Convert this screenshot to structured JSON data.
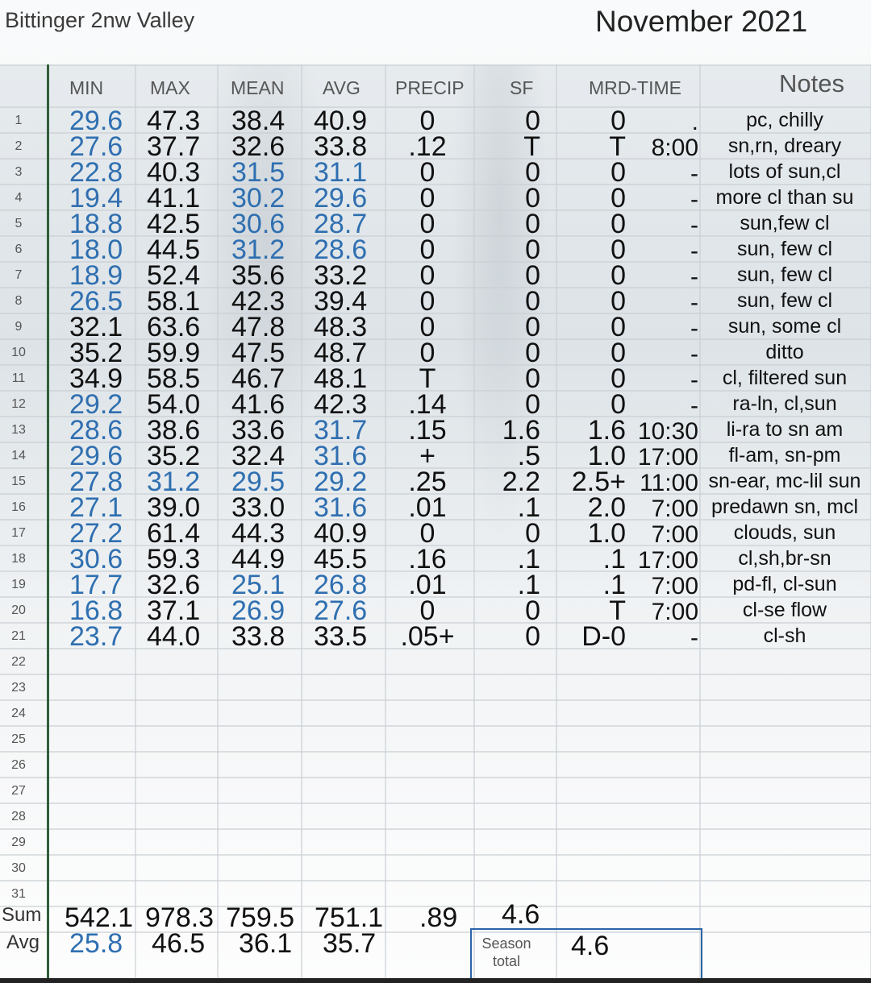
{
  "header": {
    "station": "Bittinger 2nw Valley",
    "month": "November 2021"
  },
  "columns": [
    "MIN",
    "MAX",
    "MEAN",
    "AVG",
    "PRECIP",
    "SF",
    "MRD-TIME",
    "Notes"
  ],
  "rows": [
    {
      "n": "1",
      "min": "29.6",
      "max": "47.3",
      "mean": "38.4",
      "avg": "40.9",
      "precip": "0",
      "sf": "0",
      "mrd": "0",
      "time": ".",
      "note": "pc, chilly"
    },
    {
      "n": "2",
      "min": "27.6",
      "max": "37.7",
      "mean": "32.6",
      "avg": "33.8",
      "precip": ".12",
      "sf": "T",
      "mrd": "T",
      "time": "8:00",
      "note": "sn,rn, dreary"
    },
    {
      "n": "3",
      "min": "22.8",
      "max": "40.3",
      "mean": "31.5",
      "avg": "31.1",
      "precip": "0",
      "sf": "0",
      "mrd": "0",
      "time": "-",
      "note": "lots of sun,cl"
    },
    {
      "n": "4",
      "min": "19.4",
      "max": "41.1",
      "mean": "30.2",
      "avg": "29.6",
      "precip": "0",
      "sf": "0",
      "mrd": "0",
      "time": "-",
      "note": "more cl than su"
    },
    {
      "n": "5",
      "min": "18.8",
      "max": "42.5",
      "mean": "30.6",
      "avg": "28.7",
      "precip": "0",
      "sf": "0",
      "mrd": "0",
      "time": "-",
      "note": "sun,few cl"
    },
    {
      "n": "6",
      "min": "18.0",
      "max": "44.5",
      "mean": "31.2",
      "avg": "28.6",
      "precip": "0",
      "sf": "0",
      "mrd": "0",
      "time": "-",
      "note": "sun, few cl"
    },
    {
      "n": "7",
      "min": "18.9",
      "max": "52.4",
      "mean": "35.6",
      "avg": "33.2",
      "precip": "0",
      "sf": "0",
      "mrd": "0",
      "time": "-",
      "note": "sun, few cl"
    },
    {
      "n": "8",
      "min": "26.5",
      "max": "58.1",
      "mean": "42.3",
      "avg": "39.4",
      "precip": "0",
      "sf": "0",
      "mrd": "0",
      "time": "-",
      "note": "sun, few cl"
    },
    {
      "n": "9",
      "min": "32.1",
      "max": "63.6",
      "mean": "47.8",
      "avg": "48.3",
      "precip": "0",
      "sf": "0",
      "mrd": "0",
      "time": "-",
      "note": "sun, some cl"
    },
    {
      "n": "10",
      "min": "35.2",
      "max": "59.9",
      "mean": "47.5",
      "avg": "48.7",
      "precip": "0",
      "sf": "0",
      "mrd": "0",
      "time": "-",
      "note": "ditto"
    },
    {
      "n": "11",
      "min": "34.9",
      "max": "58.5",
      "mean": "46.7",
      "avg": "48.1",
      "precip": "T",
      "sf": "0",
      "mrd": "0",
      "time": "-",
      "note": "cl, filtered sun"
    },
    {
      "n": "12",
      "min": "29.2",
      "max": "54.0",
      "mean": "41.6",
      "avg": "42.3",
      "precip": ".14",
      "sf": "0",
      "mrd": "0",
      "time": "-",
      "note": "ra-ln, cl,sun"
    },
    {
      "n": "13",
      "min": "28.6",
      "max": "38.6",
      "mean": "33.6",
      "avg": "31.7",
      "precip": ".15",
      "sf": "1.6",
      "mrd": "1.6",
      "time": "10:30",
      "note": "li-ra to sn am"
    },
    {
      "n": "14",
      "min": "29.6",
      "max": "35.2",
      "mean": "32.4",
      "avg": "31.6",
      "precip": "+",
      "sf": ".5",
      "mrd": "1.0",
      "time": "17:00",
      "note": "fl-am, sn-pm"
    },
    {
      "n": "15",
      "min": "27.8",
      "max": "31.2",
      "mean": "29.5",
      "avg": "29.2",
      "precip": ".25",
      "sf": "2.2",
      "mrd": "2.5+",
      "time": "11:00",
      "note": "sn-ear, mc-lil sun"
    },
    {
      "n": "16",
      "min": "27.1",
      "max": "39.0",
      "mean": "33.0",
      "avg": "31.6",
      "precip": ".01",
      "sf": ".1",
      "mrd": "2.0",
      "time": "7:00",
      "note": "predawn sn, mcl"
    },
    {
      "n": "17",
      "min": "27.2",
      "max": "61.4",
      "mean": "44.3",
      "avg": "40.9",
      "precip": "0",
      "sf": "0",
      "mrd": "1.0",
      "time": "7:00",
      "note": "clouds, sun"
    },
    {
      "n": "18",
      "min": "30.6",
      "max": "59.3",
      "mean": "44.9",
      "avg": "45.5",
      "precip": ".16",
      "sf": ".1",
      "mrd": ".1",
      "time": "17:00",
      "note": "cl,sh,br-sn"
    },
    {
      "n": "19",
      "min": "17.7",
      "max": "32.6",
      "mean": "25.1",
      "avg": "26.8",
      "precip": ".01",
      "sf": ".1",
      "mrd": ".1",
      "time": "7:00",
      "note": "pd-fl, cl-sun"
    },
    {
      "n": "20",
      "min": "16.8",
      "max": "37.1",
      "mean": "26.9",
      "avg": "27.6",
      "precip": "0",
      "sf": "0",
      "mrd": "T",
      "time": "7:00",
      "note": "cl-se flow"
    },
    {
      "n": "21",
      "min": "23.7",
      "max": "44.0",
      "mean": "33.8",
      "avg": "33.5",
      "precip": ".05+",
      "sf": "0",
      "mrd": "D-0",
      "time": "-",
      "note": "cl-sh"
    }
  ],
  "blue_cells": {
    "min": [
      "1",
      "2",
      "3",
      "4",
      "5",
      "6",
      "7",
      "8",
      "12",
      "13",
      "14",
      "15",
      "16",
      "17",
      "18",
      "19",
      "20",
      "21"
    ],
    "max": [
      "15"
    ],
    "mean": [
      "3",
      "4",
      "5",
      "6",
      "15",
      "19",
      "20"
    ],
    "avg": [
      "3",
      "4",
      "5",
      "6",
      "13",
      "14",
      "15",
      "16",
      "19",
      "20"
    ]
  },
  "empty_rows": [
    "22",
    "23",
    "24",
    "25",
    "26",
    "27",
    "28",
    "29",
    "30",
    "31"
  ],
  "sum": {
    "label": "Sum",
    "min": "542.1",
    "max": "978.3",
    "mean": "759.5",
    "avg": "751.1",
    "precip": ".89",
    "sf": "4.6"
  },
  "average": {
    "label": "Avg",
    "min": "25.8",
    "max": "46.5",
    "mean": "36.1",
    "avg": "35.7"
  },
  "season": {
    "label_line1": "Season",
    "label_line2": "total",
    "value": "4.6"
  },
  "colors": {
    "blue": "#2f6fb0",
    "grid": "#c9cfd4",
    "text": "#111111"
  }
}
